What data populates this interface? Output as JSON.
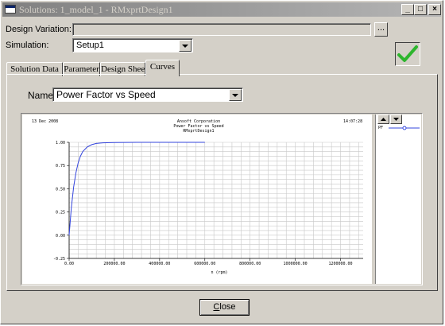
{
  "window": {
    "title": "Solutions: 1_model_1 - RMxprtDesign1",
    "min_label": "_",
    "max_label": "□",
    "close_label": "×"
  },
  "design_variation": {
    "label": "Design Variation:",
    "value": "",
    "browse_label": "..."
  },
  "simulation": {
    "label": "Simulation:",
    "value": "Setup1"
  },
  "tabs": [
    {
      "label": "Solution Data",
      "active": false
    },
    {
      "label": "Parameter",
      "active": false
    },
    {
      "label": "Design Sheet",
      "active": false
    },
    {
      "label": "Curves",
      "active": true
    }
  ],
  "curves": {
    "name_label": "Name:",
    "name_value": "Power Factor vs Speed"
  },
  "chart_data": {
    "type": "line",
    "header_left": "13 Dec 2008",
    "header_right": "14:07:28",
    "title_lines": [
      "Ansoft Corporation",
      "Power Factor vs Speed",
      "RMxprtDesign1"
    ],
    "xlabel": "n (rpm)",
    "ylabel": "",
    "xlim": [
      0,
      1300000
    ],
    "ylim": [
      -0.25,
      1.0
    ],
    "x_ticks": [
      0,
      200000,
      400000,
      600000,
      800000,
      1000000,
      1200000
    ],
    "x_tick_labels": [
      "0.00",
      "200000.00",
      "400000.00",
      "600000.00",
      "800000.00",
      "1000000.00",
      "1200000.00"
    ],
    "y_ticks": [
      -0.25,
      0.0,
      0.25,
      0.5,
      0.75,
      1.0
    ],
    "y_tick_labels": [
      "-0.25",
      "0.00",
      "0.25",
      "0.50",
      "0.75",
      "1.00"
    ],
    "grid": true,
    "series": [
      {
        "name": "PF",
        "color": "#3344dd",
        "x": [
          0,
          10000,
          20000,
          30000,
          40000,
          50000,
          60000,
          80000,
          100000,
          120000,
          150000,
          200000,
          250000,
          300000,
          400000,
          500000,
          600000
        ],
        "y": [
          0.0,
          0.3,
          0.52,
          0.67,
          0.78,
          0.85,
          0.9,
          0.95,
          0.975,
          0.988,
          0.995,
          0.998,
          0.999,
          1.0,
          1.0,
          1.0,
          1.0
        ]
      }
    ],
    "legend": [
      {
        "label": "PF",
        "color": "#3344dd"
      }
    ]
  },
  "buttons": {
    "close_prefix": "C",
    "close_rest": "lose"
  },
  "colors": {
    "accept_check": "#2db52d",
    "titlebar_start": "#808080"
  }
}
